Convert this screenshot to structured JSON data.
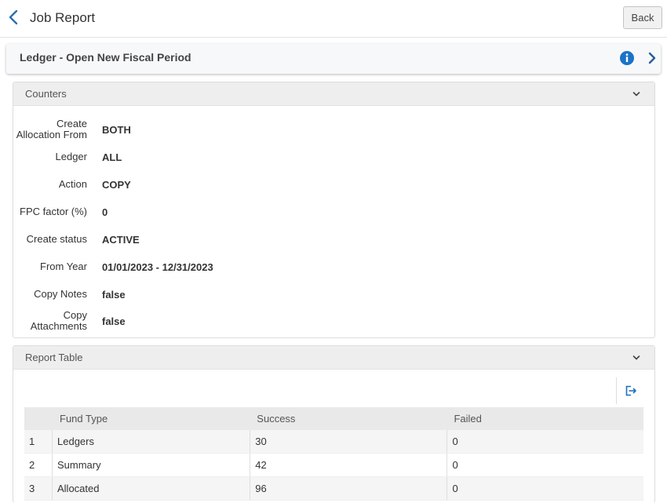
{
  "header": {
    "title": "Job Report",
    "back_label": "Back"
  },
  "process": {
    "title": "Ledger - Open New Fiscal Period"
  },
  "counters": {
    "title": "Counters",
    "rows": [
      {
        "label_line1": "Create",
        "label_line2": "Allocation From",
        "value": "BOTH"
      },
      {
        "label": "Ledger",
        "value": "ALL"
      },
      {
        "label": "Action",
        "value": "COPY"
      },
      {
        "label": "FPC factor (%)",
        "value": "0"
      },
      {
        "label": "Create status",
        "value": "ACTIVE"
      },
      {
        "label": "From Year",
        "value": "01/01/2023 - 12/31/2023"
      },
      {
        "label": "Copy Notes",
        "value": "false"
      },
      {
        "label_line1": "Copy",
        "label_line2": "Attachments",
        "value": "false"
      }
    ]
  },
  "report": {
    "title": "Report Table",
    "columns": [
      "",
      "Fund Type",
      "Success",
      "Failed"
    ],
    "rows": [
      [
        "1",
        "Ledgers",
        "30",
        "0"
      ],
      [
        "2",
        "Summary",
        "42",
        "0"
      ],
      [
        "3",
        "Allocated",
        "96",
        "0"
      ]
    ]
  },
  "colors": {
    "accent": "#1f6fb8",
    "info": "#1a73c7"
  }
}
